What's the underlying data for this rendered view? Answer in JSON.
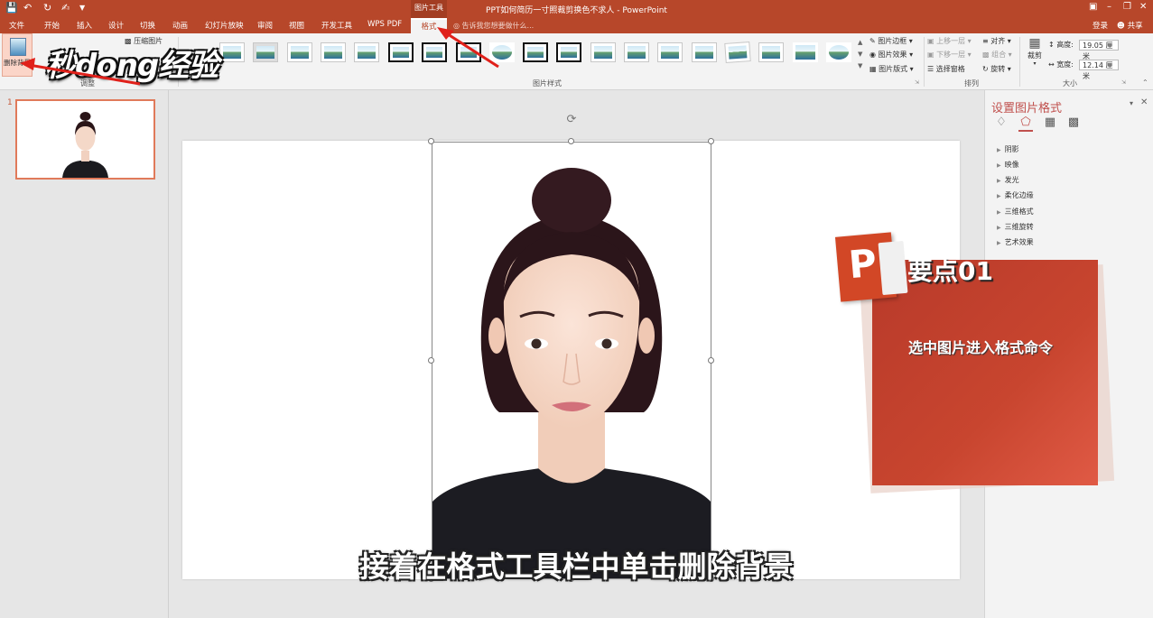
{
  "titlebar": {
    "document_title": "PPT如何简历一寸照裁剪换色不求人 - PowerPoint",
    "context_group": "图片工具",
    "quick_access": [
      "save-icon",
      "undo-icon",
      "redo-icon",
      "touch-mode-icon",
      "customize-icon"
    ],
    "window_controls": [
      "ribbon-display-icon",
      "minimize-icon",
      "restore-icon",
      "close-icon"
    ]
  },
  "tabs": [
    "文件",
    "开始",
    "插入",
    "设计",
    "切换",
    "动画",
    "幻灯片放映",
    "审阅",
    "视图",
    "开发工具",
    "WPS PDF"
  ],
  "active_tab": "格式",
  "tell_me": "告诉我您想要做什么...",
  "account": {
    "login": "登录",
    "share": "共享"
  },
  "ribbon": {
    "remove_bg_label": "删除背景",
    "compress_label": "压缩图片",
    "group_adjust": "调整",
    "group_styles": "图片样式",
    "group_arrange": "排列",
    "group_size": "大小",
    "picture_border": "图片边框",
    "picture_effects": "图片效果",
    "picture_layout": "图片版式",
    "bring_forward": "上移一层",
    "send_backward": "下移一层",
    "selection_pane": "选择窗格",
    "align": "对齐",
    "group": "组合",
    "rotate": "旋转",
    "crop": "裁剪",
    "height_label": "高度:",
    "height_value": "19.05 厘米",
    "width_label": "宽度:",
    "width_value": "12.14 厘米"
  },
  "watermark": "秒dong经验",
  "slides": {
    "current_number": "1"
  },
  "format_pane": {
    "title": "设置图片格式",
    "icons": [
      "fill-line-icon",
      "effects-icon",
      "size-properties-icon",
      "picture-icon"
    ],
    "sections": [
      "阴影",
      "映像",
      "发光",
      "柔化边缘",
      "三维格式",
      "三维旋转",
      "艺术效果"
    ]
  },
  "callout": {
    "badge": "要点01",
    "text": "选中图片进入格式命令",
    "logo_letter": "P"
  },
  "subtitle": "接着在格式工具栏中单击删除背景",
  "colors": {
    "accent": "#b7472a",
    "callout": "#c8452f",
    "pane_title": "#c0504d"
  }
}
